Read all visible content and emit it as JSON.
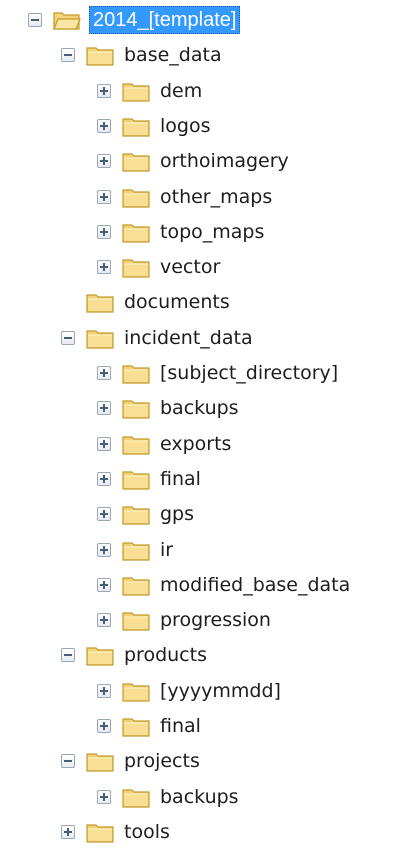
{
  "tree": {
    "colors": {
      "folder_body": "#f2d27a",
      "folder_edge": "#c49a2c",
      "selection": "#3399ff",
      "toggle_glyph": "#4a5d75"
    },
    "nodes": [
      {
        "label": "2014_[template]",
        "depth": 0,
        "toggle": "minus",
        "icon": "open-folder-icon",
        "selected": true
      },
      {
        "label": "base_data",
        "depth": 1,
        "toggle": "minus",
        "icon": "folder-icon",
        "selected": false
      },
      {
        "label": "dem",
        "depth": 2,
        "toggle": "plus",
        "icon": "folder-icon",
        "selected": false
      },
      {
        "label": "logos",
        "depth": 2,
        "toggle": "plus",
        "icon": "folder-icon",
        "selected": false
      },
      {
        "label": "orthoimagery",
        "depth": 2,
        "toggle": "plus",
        "icon": "folder-icon",
        "selected": false
      },
      {
        "label": "other_maps",
        "depth": 2,
        "toggle": "plus",
        "icon": "folder-icon",
        "selected": false
      },
      {
        "label": "topo_maps",
        "depth": 2,
        "toggle": "plus",
        "icon": "folder-icon",
        "selected": false
      },
      {
        "label": "vector",
        "depth": 2,
        "toggle": "plus",
        "icon": "folder-icon",
        "selected": false
      },
      {
        "label": "documents",
        "depth": 1,
        "toggle": "none",
        "icon": "folder-icon",
        "selected": false
      },
      {
        "label": "incident_data",
        "depth": 1,
        "toggle": "minus",
        "icon": "folder-icon",
        "selected": false
      },
      {
        "label": "[subject_directory]",
        "depth": 2,
        "toggle": "plus",
        "icon": "folder-icon",
        "selected": false
      },
      {
        "label": "backups",
        "depth": 2,
        "toggle": "plus",
        "icon": "folder-icon",
        "selected": false
      },
      {
        "label": "exports",
        "depth": 2,
        "toggle": "plus",
        "icon": "folder-icon",
        "selected": false
      },
      {
        "label": "final",
        "depth": 2,
        "toggle": "plus",
        "icon": "folder-icon",
        "selected": false
      },
      {
        "label": "gps",
        "depth": 2,
        "toggle": "plus",
        "icon": "folder-icon",
        "selected": false
      },
      {
        "label": "ir",
        "depth": 2,
        "toggle": "plus",
        "icon": "folder-icon",
        "selected": false
      },
      {
        "label": "modified_base_data",
        "depth": 2,
        "toggle": "plus",
        "icon": "folder-icon",
        "selected": false
      },
      {
        "label": "progression",
        "depth": 2,
        "toggle": "plus",
        "icon": "folder-icon",
        "selected": false
      },
      {
        "label": "products",
        "depth": 1,
        "toggle": "minus",
        "icon": "folder-icon",
        "selected": false
      },
      {
        "label": "[yyyymmdd]",
        "depth": 2,
        "toggle": "plus",
        "icon": "folder-icon",
        "selected": false
      },
      {
        "label": "final",
        "depth": 2,
        "toggle": "plus",
        "icon": "folder-icon",
        "selected": false
      },
      {
        "label": "projects",
        "depth": 1,
        "toggle": "minus",
        "icon": "folder-icon",
        "selected": false
      },
      {
        "label": "backups",
        "depth": 2,
        "toggle": "plus",
        "icon": "folder-icon",
        "selected": false
      },
      {
        "label": "tools",
        "depth": 1,
        "toggle": "plus",
        "icon": "folder-icon",
        "selected": false
      }
    ]
  }
}
